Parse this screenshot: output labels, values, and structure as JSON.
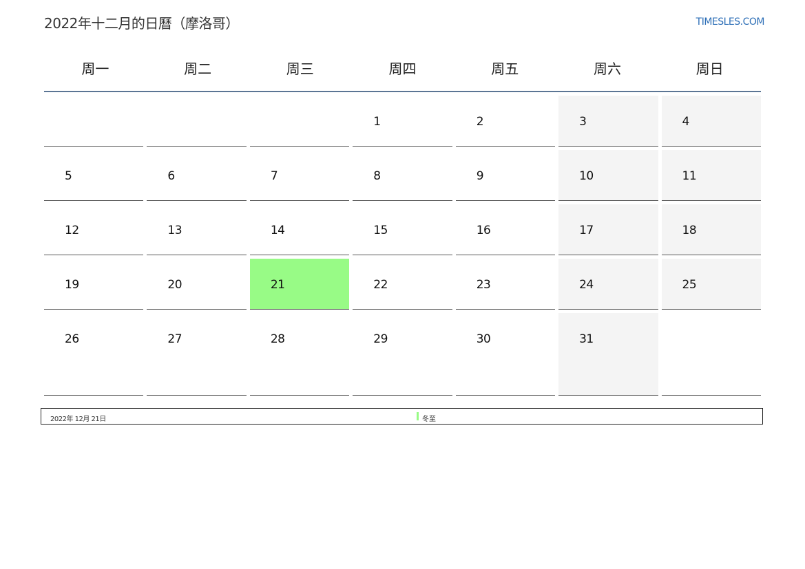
{
  "header": {
    "title": "2022年十二月的日曆（摩洛哥）",
    "site": "TIMESLES.COM"
  },
  "calendar": {
    "weekdays": [
      "周一",
      "周二",
      "周三",
      "周四",
      "周五",
      "周六",
      "周日"
    ],
    "weeks": [
      [
        "",
        "",
        "",
        "1",
        "2",
        "3",
        "4"
      ],
      [
        "5",
        "6",
        "7",
        "8",
        "9",
        "10",
        "11"
      ],
      [
        "12",
        "13",
        "14",
        "15",
        "16",
        "17",
        "18"
      ],
      [
        "19",
        "20",
        "21",
        "22",
        "23",
        "24",
        "25"
      ],
      [
        "26",
        "27",
        "28",
        "29",
        "30",
        "31",
        ""
      ]
    ],
    "highlight_day": "21"
  },
  "legend": {
    "date": "2022年 12月 21日",
    "holiday": "冬至"
  },
  "colors": {
    "accent_line": "#5b7594",
    "holiday": "#98fb86",
    "weekend": "#f4f4f4",
    "link": "#2e6fb7"
  }
}
